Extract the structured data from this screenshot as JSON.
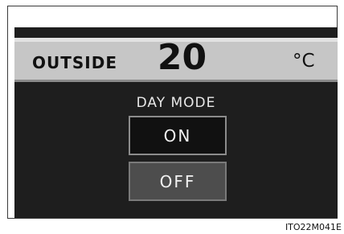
{
  "outside": {
    "label": "OUTSIDE",
    "temperature": "20",
    "unit": "°C"
  },
  "day_mode": {
    "title": "DAY MODE",
    "on_label": "ON",
    "off_label": "OFF",
    "selected": "OFF"
  },
  "figure_code": "ITO22M041E",
  "colors": {
    "screen_bg": "#1e1e1e",
    "band_bg": "#c6c6c6",
    "on_button_bg": "#111111",
    "off_button_bg": "#4d4d4d"
  }
}
